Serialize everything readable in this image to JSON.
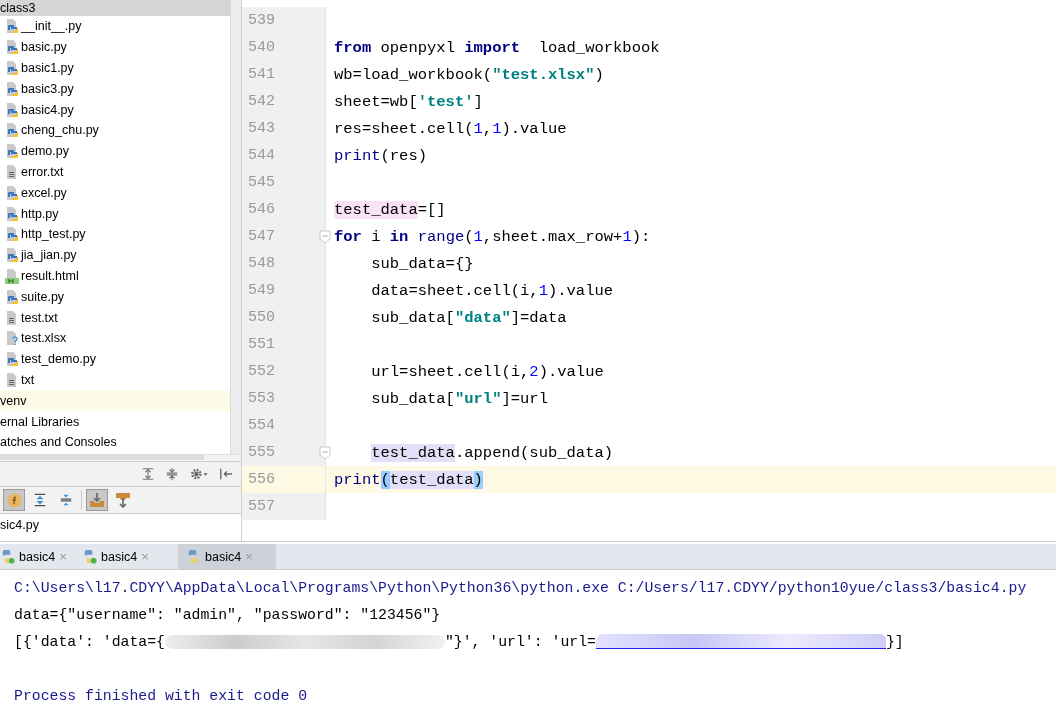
{
  "project_tree": [
    {
      "label": "class3",
      "selected": true,
      "current": false,
      "children": [
        {
          "label": "__init__.py",
          "kind": "py"
        },
        {
          "label": "basic.py",
          "kind": "py"
        },
        {
          "label": "basic1.py",
          "kind": "py"
        },
        {
          "label": "basic3.py",
          "kind": "py"
        },
        {
          "label": "basic4.py",
          "kind": "py"
        },
        {
          "label": "cheng_chu.py",
          "kind": "py"
        },
        {
          "label": "demo.py",
          "kind": "py"
        },
        {
          "label": "error.txt",
          "kind": "txt"
        },
        {
          "label": "excel.py",
          "kind": "py"
        },
        {
          "label": "http.py",
          "kind": "py"
        },
        {
          "label": "http_test.py",
          "kind": "py"
        },
        {
          "label": "jia_jian.py",
          "kind": "py"
        },
        {
          "label": "result.html",
          "kind": "html"
        },
        {
          "label": "suite.py",
          "kind": "py"
        },
        {
          "label": "test.txt",
          "kind": "txt"
        },
        {
          "label": "test.xlsx",
          "kind": "unknown"
        },
        {
          "label": "test_demo.py",
          "kind": "py"
        },
        {
          "label": "txt",
          "kind": "txt"
        }
      ]
    },
    {
      "label": "venv",
      "selected": false,
      "current": true
    },
    {
      "label": "ernal Libraries",
      "selected": false,
      "current": false
    },
    {
      "label": "atches and Consoles",
      "selected": false,
      "current": false
    }
  ],
  "structure_toolbar": [
    {
      "kind": "expand"
    },
    {
      "kind": "collapse"
    },
    {
      "kind": "gear"
    },
    {
      "kind": "hide"
    }
  ],
  "structure_toolbar_2": [
    {
      "kind": "fields",
      "on": true
    },
    {
      "kind": "expand",
      "on": false
    },
    {
      "kind": "collapse",
      "on": false
    },
    {
      "kind": "sep"
    },
    {
      "kind": "from_source",
      "on": true
    },
    {
      "kind": "to_source",
      "on": false
    }
  ],
  "structure_items": [
    {
      "label": "sic4.py"
    }
  ],
  "editor": {
    "lines": [
      {
        "number": "539",
        "current": false,
        "fold": false,
        "indented": false
      },
      {
        "number": "540",
        "current": false,
        "fold": false,
        "indented": false,
        "segments": [
          {
            "text": "from",
            "kind": "kw"
          },
          {
            "text": " openpyxl ",
            "kind": "plain"
          },
          {
            "text": "import",
            "kind": "kw"
          },
          {
            "text": "  load_workbook",
            "kind": "plain"
          }
        ]
      },
      {
        "number": "541",
        "current": false,
        "fold": false,
        "indented": false,
        "segments": [
          {
            "text": "wb=load_workbook(",
            "kind": "plain"
          },
          {
            "text": "\"test.xlsx\"",
            "kind": "str"
          },
          {
            "text": ")",
            "kind": "plain"
          }
        ]
      },
      {
        "number": "542",
        "current": false,
        "fold": false,
        "indented": false,
        "segments": [
          {
            "text": "sheet=wb[",
            "kind": "plain"
          },
          {
            "text": "'test'",
            "kind": "str"
          },
          {
            "text": "]",
            "kind": "plain"
          }
        ]
      },
      {
        "number": "543",
        "current": false,
        "fold": false,
        "indented": false,
        "segments": [
          {
            "text": "res=sheet.cell(",
            "kind": "plain"
          },
          {
            "text": "1",
            "kind": "num"
          },
          {
            "text": ",",
            "kind": "plain"
          },
          {
            "text": "1",
            "kind": "num"
          },
          {
            "text": ").value",
            "kind": "plain"
          }
        ]
      },
      {
        "number": "544",
        "current": false,
        "fold": false,
        "indented": false,
        "segments": [
          {
            "text": "print",
            "kind": "builtin"
          },
          {
            "text": "(res)",
            "kind": "plain"
          }
        ]
      },
      {
        "number": "545",
        "current": false,
        "fold": false,
        "indented": false
      },
      {
        "number": "546",
        "current": false,
        "fold": false,
        "indented": false,
        "segments": [
          {
            "text": "test_data",
            "kind": "def_hl"
          },
          {
            "text": "=[]",
            "kind": "plain"
          }
        ]
      },
      {
        "number": "547",
        "current": false,
        "fold": true,
        "indented": false,
        "segments": [
          {
            "text": "for",
            "kind": "kw"
          },
          {
            "text": " i ",
            "kind": "plain"
          },
          {
            "text": "in",
            "kind": "kw"
          },
          {
            "text": " range",
            "kind": "builtin"
          },
          {
            "text": "(",
            "kind": "plain"
          },
          {
            "text": "1",
            "kind": "num"
          },
          {
            "text": ",sheet.max_row+",
            "kind": "plain"
          },
          {
            "text": "1",
            "kind": "num"
          },
          {
            "text": "):",
            "kind": "plain"
          }
        ]
      },
      {
        "number": "548",
        "current": false,
        "fold": false,
        "indented": true,
        "segments": [
          {
            "text": "sub_data={}",
            "kind": "plain"
          }
        ]
      },
      {
        "number": "549",
        "current": false,
        "fold": false,
        "indented": true,
        "segments": [
          {
            "text": "data=sheet.cell(i,",
            "kind": "plain"
          },
          {
            "text": "1",
            "kind": "num"
          },
          {
            "text": ").value",
            "kind": "plain"
          }
        ]
      },
      {
        "number": "550",
        "current": false,
        "fold": false,
        "indented": true,
        "segments": [
          {
            "text": "sub_data[",
            "kind": "plain"
          },
          {
            "text": "\"data\"",
            "kind": "str"
          },
          {
            "text": "]=data",
            "kind": "plain"
          }
        ]
      },
      {
        "number": "551",
        "current": false,
        "fold": false,
        "indented": false
      },
      {
        "number": "552",
        "current": false,
        "fold": false,
        "indented": true,
        "segments": [
          {
            "text": "url=sheet.cell(i,",
            "kind": "plain"
          },
          {
            "text": "2",
            "kind": "num"
          },
          {
            "text": ").value",
            "kind": "plain"
          }
        ]
      },
      {
        "number": "553",
        "current": false,
        "fold": false,
        "indented": true,
        "segments": [
          {
            "text": "sub_data[",
            "kind": "plain"
          },
          {
            "text": "\"url\"",
            "kind": "str"
          },
          {
            "text": "]=url",
            "kind": "plain"
          }
        ]
      },
      {
        "number": "554",
        "current": false,
        "fold": false,
        "indented": false
      },
      {
        "number": "555",
        "current": false,
        "fold": true,
        "indented": true,
        "segments": [
          {
            "text": "test_data",
            "kind": "ref_hl"
          },
          {
            "text": ".append(sub_data)",
            "kind": "plain"
          }
        ]
      },
      {
        "number": "556",
        "current": true,
        "fold": false,
        "indented": false,
        "segments": [
          {
            "text": "print",
            "kind": "builtin"
          },
          {
            "text": "(",
            "kind": "brace"
          },
          {
            "text": "test_data",
            "kind": "ref_hl"
          },
          {
            "text": ")",
            "kind": "brace"
          }
        ]
      },
      {
        "number": "557",
        "current": false,
        "fold": false,
        "indented": false
      }
    ]
  },
  "run_tabs": [
    {
      "label": "basic4",
      "close": "×",
      "selected": false,
      "running": true
    },
    {
      "label": "basic4",
      "close": "×",
      "selected": false,
      "running": true
    },
    {
      "label": "basic4",
      "close": "×",
      "selected": true,
      "running": false
    }
  ],
  "console": [
    {
      "kind": "system",
      "segments": [
        {
          "kind": "text",
          "text": "C:\\Users\\l17.CDYY\\AppData\\Local\\Programs\\Python\\Python36\\python.exe C:/Users/l17.CDYY/python10yue/class3/basic4.py"
        }
      ]
    },
    {
      "kind": "output",
      "segments": [
        {
          "kind": "text",
          "text": "data={\"username\": \"admin\", \"password\": \"123456\"}"
        }
      ]
    },
    {
      "kind": "output",
      "segments": [
        {
          "kind": "text",
          "text": "[{'data': 'data={"
        },
        {
          "kind": "blur"
        },
        {
          "kind": "text",
          "text": "\"}', 'url': 'url="
        },
        {
          "kind": "blur_link"
        },
        {
          "kind": "text",
          "text": "}]"
        }
      ]
    },
    {
      "kind": "blank"
    },
    {
      "kind": "system",
      "segments": [
        {
          "kind": "text",
          "text": "Process finished with exit code 0"
        }
      ]
    }
  ]
}
